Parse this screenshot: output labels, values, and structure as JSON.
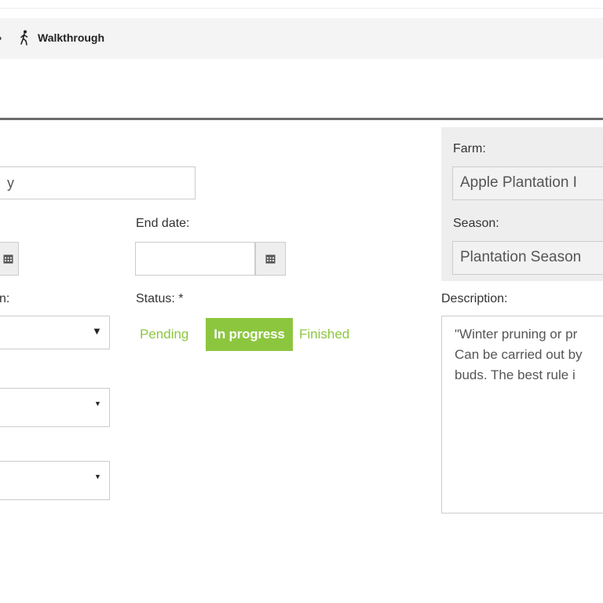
{
  "toolbar": {
    "walkthrough_label": "Walkthrough",
    "walk_icon": "walking-person-icon",
    "partial_icon": "circle-icon"
  },
  "form": {
    "name_value": "y",
    "end_date_label": "End date:",
    "end_date_value": "",
    "partial_label": "n:",
    "status_label": "Status: *",
    "status_options": [
      "Pending",
      "In progress",
      "Finished"
    ],
    "status_selected": "In progress",
    "caret_glyph": "▼"
  },
  "side": {
    "farm_label": "Farm:",
    "farm_value": "Apple Plantation I",
    "season_label": "Season:",
    "season_value": "Plantation Season",
    "description_label": "Description:",
    "description_text": "\"Winter pruning or pr\nCan be carried out by\nbuds. The best rule i"
  },
  "colors": {
    "accent_green": "#8cc63f",
    "toolbar_bg": "#f4f4f4",
    "divider": "#6b6b6b"
  }
}
